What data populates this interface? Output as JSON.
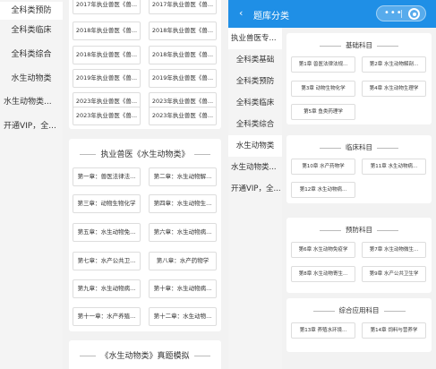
{
  "left": {
    "sidebar": [
      {
        "label": "全科类预防"
      },
      {
        "label": "全科类临床"
      },
      {
        "label": "全科类综合"
      },
      {
        "label": "水生动物类"
      },
      {
        "label": "水生动物类..."
      },
      {
        "label": "开通VIP，全..."
      }
    ],
    "top_cells": [
      "2017年执业兽医《兽...",
      "2017年执业兽医《兽...",
      "2018年执业兽医《兽...",
      "2018年执业兽医《兽...",
      "2018年执业兽医《兽...",
      "2018年执业兽医《兽...",
      "2019年执业兽医《兽...",
      "2019年执业兽医《兽...",
      "2023年执业兽医《兽...",
      "2023年执业兽医《兽...",
      "2023年执业兽医《兽...",
      "2023年执业兽医《兽..."
    ],
    "card2": {
      "title": "执业兽医《水生动物类》",
      "cells": [
        "第一章：兽医法律法...",
        "第二章：水生动物解...",
        "第三章：动物生物化学",
        "第四章：水生动物生...",
        "第五章：水生动物免...",
        "第六章：水生动物病...",
        "第七章：水产公共卫...",
        "第八章：水产药物学",
        "第九章：水生动物病...",
        "第十章：水生动物病...",
        "第十一章：水产养殖...",
        "第十二章：水生动物..."
      ]
    },
    "card3": {
      "title": "《水生动物类》真题模拟"
    }
  },
  "right": {
    "header": {
      "back": "‹",
      "title": "题库分类",
      "capsule_dots": "•••"
    },
    "sidebar": [
      {
        "label": "执业兽医专..."
      },
      {
        "label": "全科类基础"
      },
      {
        "label": "全科类预防"
      },
      {
        "label": "全科类临床"
      },
      {
        "label": "全科类综合"
      },
      {
        "label": "水生动物类"
      },
      {
        "label": "水生动物类..."
      },
      {
        "label": "开通VIP，全..."
      }
    ],
    "sections": [
      {
        "title": "基础科目",
        "cells": [
          "第1章 兽医法律法规...",
          "第2章 水生动物解剖...",
          "第3章 动物生物化学",
          "第4章 水生动物生理学",
          "第5章 鱼类药理学"
        ]
      },
      {
        "title": "临床科目",
        "cells": [
          "第10章 水产药物学",
          "第11章 水生动物病...",
          "第12章 水生动物病..."
        ]
      },
      {
        "title": "预防科目",
        "cells": [
          "第6章 水生动物免疫学",
          "第7章 水生动物微生...",
          "第8章 水生动物寄生...",
          "第9章 水产公共卫生学"
        ]
      },
      {
        "title": "综合应用科目",
        "cells": [
          "第13章 养殖水环境...",
          "第14章 饲料与营养学"
        ]
      }
    ]
  },
  "colors": {
    "header_blue": "#1f8fe6",
    "page_bg": "#f2f2f2",
    "sidebar_bg": "#f4f4f4",
    "card_bg": "#ffffff",
    "border": "#dddddd"
  }
}
